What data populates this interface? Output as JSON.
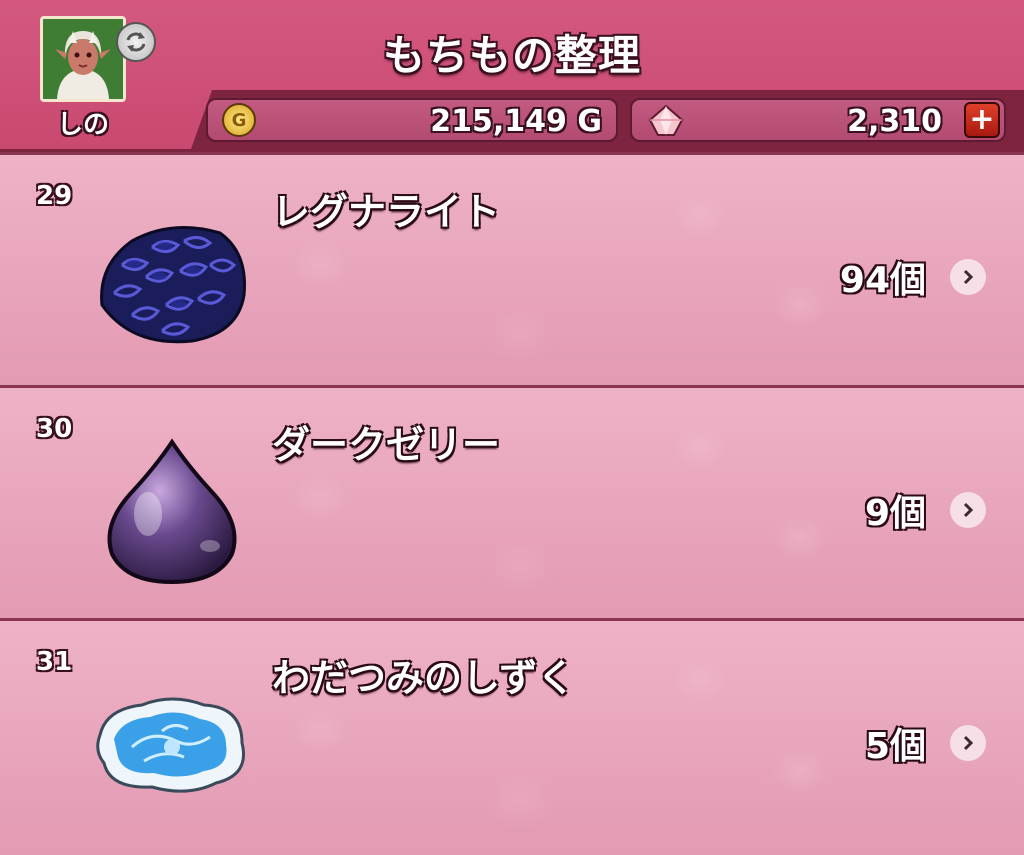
{
  "header": {
    "title": "もちもの整理",
    "character_name": "しの",
    "gold": "215,149 G",
    "gems": "2,310",
    "plus_label": "+"
  },
  "items": [
    {
      "number": "29",
      "name": "レグナライト",
      "count": "94個",
      "icon": "regnalite-ore-icon"
    },
    {
      "number": "30",
      "name": "ダークゼリー",
      "count": "9個",
      "icon": "dark-jelly-icon"
    },
    {
      "number": "31",
      "name": "わだつみのしずく",
      "count": "5個",
      "icon": "wadatsumi-drop-icon"
    }
  ],
  "colors": {
    "header_bg": "#c9496f",
    "row_bg": "#e9a6bd",
    "divider": "#8a3552"
  }
}
